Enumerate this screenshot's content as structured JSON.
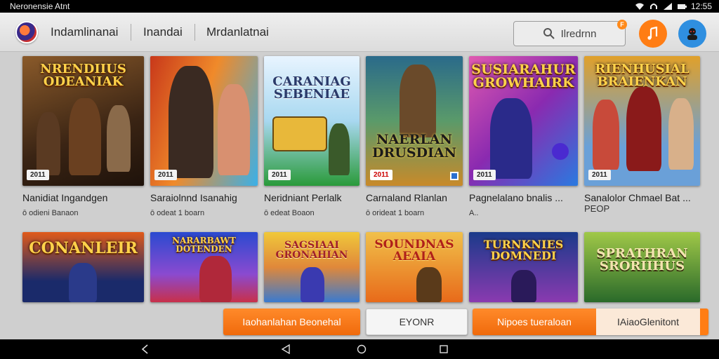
{
  "status_bar": {
    "app_title": "Neronensie Atnt",
    "time": "12:55",
    "icons": [
      "wifi-icon",
      "headset-icon",
      "signal-icon",
      "battery-icon"
    ]
  },
  "header": {
    "logo": "app-logo",
    "tabs": [
      {
        "label": "Indamlinanai"
      },
      {
        "label": "Inandai"
      },
      {
        "label": "Mrdanlatnai"
      }
    ],
    "search": {
      "placeholder": "Ilredrnn",
      "icon": "search-icon"
    },
    "notification_badge": "F",
    "actions": [
      {
        "icon": "music-note-icon"
      },
      {
        "icon": "avatar-icon"
      }
    ]
  },
  "games_row1": [
    {
      "art_text": "NRENDIIUS ODEANIAK",
      "title": "Nanidiat Ingandgen",
      "subtitle": "ō odieni Banaon",
      "tag": "2011",
      "colors": [
        "#3a2414",
        "#8a5a2a"
      ]
    },
    {
      "art_text": "",
      "title": "Saraiolnnd Isanahig",
      "subtitle": "ō odeat 1 boarn",
      "tag": "2011",
      "colors": [
        "#c8381a",
        "#3ab0e8"
      ]
    },
    {
      "art_text": "CARANIAG SEBENIAE",
      "title": "Neridniant Perlalk",
      "subtitle": "ō edeat Boaon",
      "tag": "2011",
      "colors": [
        "#e8f4ff",
        "#2a9a3a"
      ]
    },
    {
      "art_text": "NAERLAN DRUSDIAN",
      "title": "Carnaland Rlanlan",
      "subtitle": "ō orideat 1 boarn",
      "tag": "2011",
      "colors": [
        "#2a6a8a",
        "#c88a2a"
      ]
    },
    {
      "art_text": "SUSIARAHUR GROWHAIRK",
      "title": "Pagnelalano bnalis ...",
      "subtitle": "A..",
      "tag": "2011",
      "colors": [
        "#8a2ab0",
        "#2a7ae0"
      ]
    },
    {
      "art_text": "RIENHUSIAL BRAIENKAN",
      "title": "Sanalolor Chmael Bat ...",
      "subtitle": "PEOP",
      "tag": "2011",
      "colors": [
        "#e0a02a",
        "#6aa0d8"
      ]
    }
  ],
  "games_row2": [
    {
      "art_text": "CONANLEIR",
      "colors": [
        "#1a2a6a",
        "#e05a1a"
      ]
    },
    {
      "art_text": "NARARBAWT DOTENDEN",
      "colors": [
        "#2a4ad0",
        "#c8304a"
      ]
    },
    {
      "art_text": "SAGSIAAI GRONAHIAN",
      "colors": [
        "#f0c83a",
        "#3a7ad0"
      ]
    },
    {
      "art_text": "SOUNDNAS AEAIA",
      "colors": [
        "#e86a1a",
        "#f0c04a"
      ]
    },
    {
      "art_text": "TURNKNIES DOMNEDI",
      "colors": [
        "#1a3a8a",
        "#8a3ab0"
      ]
    },
    {
      "art_text": "SPRATHRAN SRORIIHUS",
      "colors": [
        "#2a6a2a",
        "#a0c848"
      ]
    }
  ],
  "bottom_actions": {
    "primary": "Iaohanlahan Beonehal",
    "secondary": "EYONR",
    "split_left": "Nipoes tueraloan",
    "split_right": "IAiaoGlenitont"
  },
  "nav_bar": {
    "icons": [
      "back-icon",
      "home-icon",
      "recents-icon"
    ]
  }
}
